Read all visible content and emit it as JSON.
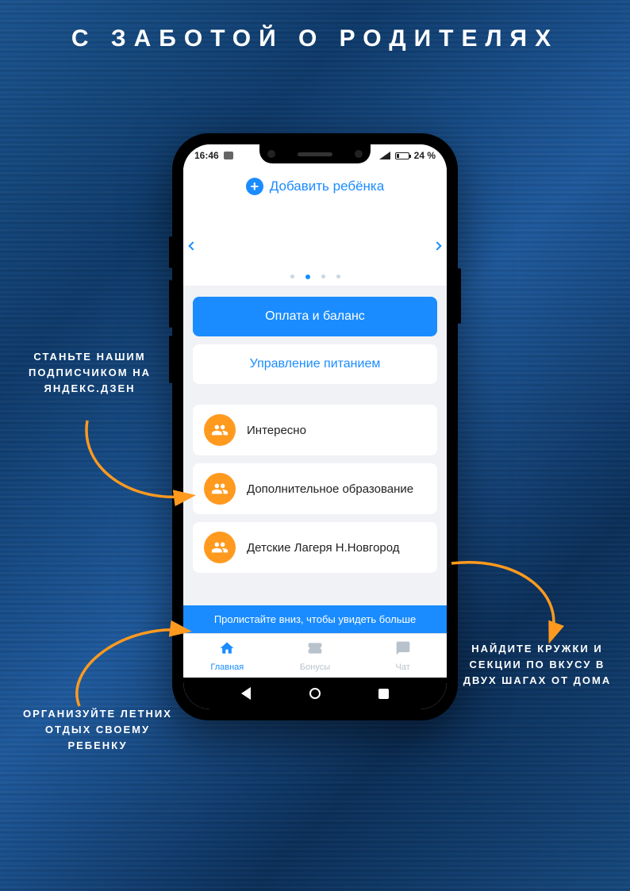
{
  "heading": "С ЗАБОТОЙ О РОДИТЕЛЯХ",
  "status": {
    "time": "16:46",
    "battery": "24 %"
  },
  "app": {
    "add_child": "Добавить ребёнка",
    "pay_button": "Оплата и баланс",
    "manage_button": "Управление питанием",
    "items": [
      {
        "label": "Интересно"
      },
      {
        "label": "Дополнительное образование"
      },
      {
        "label": "Детские Лагеря Н.Новгород"
      }
    ],
    "scroll_hint": "Пролистайте вниз, чтобы увидеть больше",
    "tabs": {
      "home": "Главная",
      "bonus": "Бонусы",
      "chat": "Чат"
    }
  },
  "callouts": {
    "c1": "СТАНЬТЕ НАШИМ ПОДПИСЧИКОМ НА ЯНДЕКС.ДЗЕН",
    "c2": "ОРГАНИЗУЙТЕ ЛЕТНИХ ОТДЫХ СВОЕМУ РЕБЕНКУ",
    "c3": "НАЙДИТЕ КРУЖКИ И СЕКЦИИ ПО ВКУСУ В ДВУХ ШАГАХ ОТ ДОМА"
  }
}
